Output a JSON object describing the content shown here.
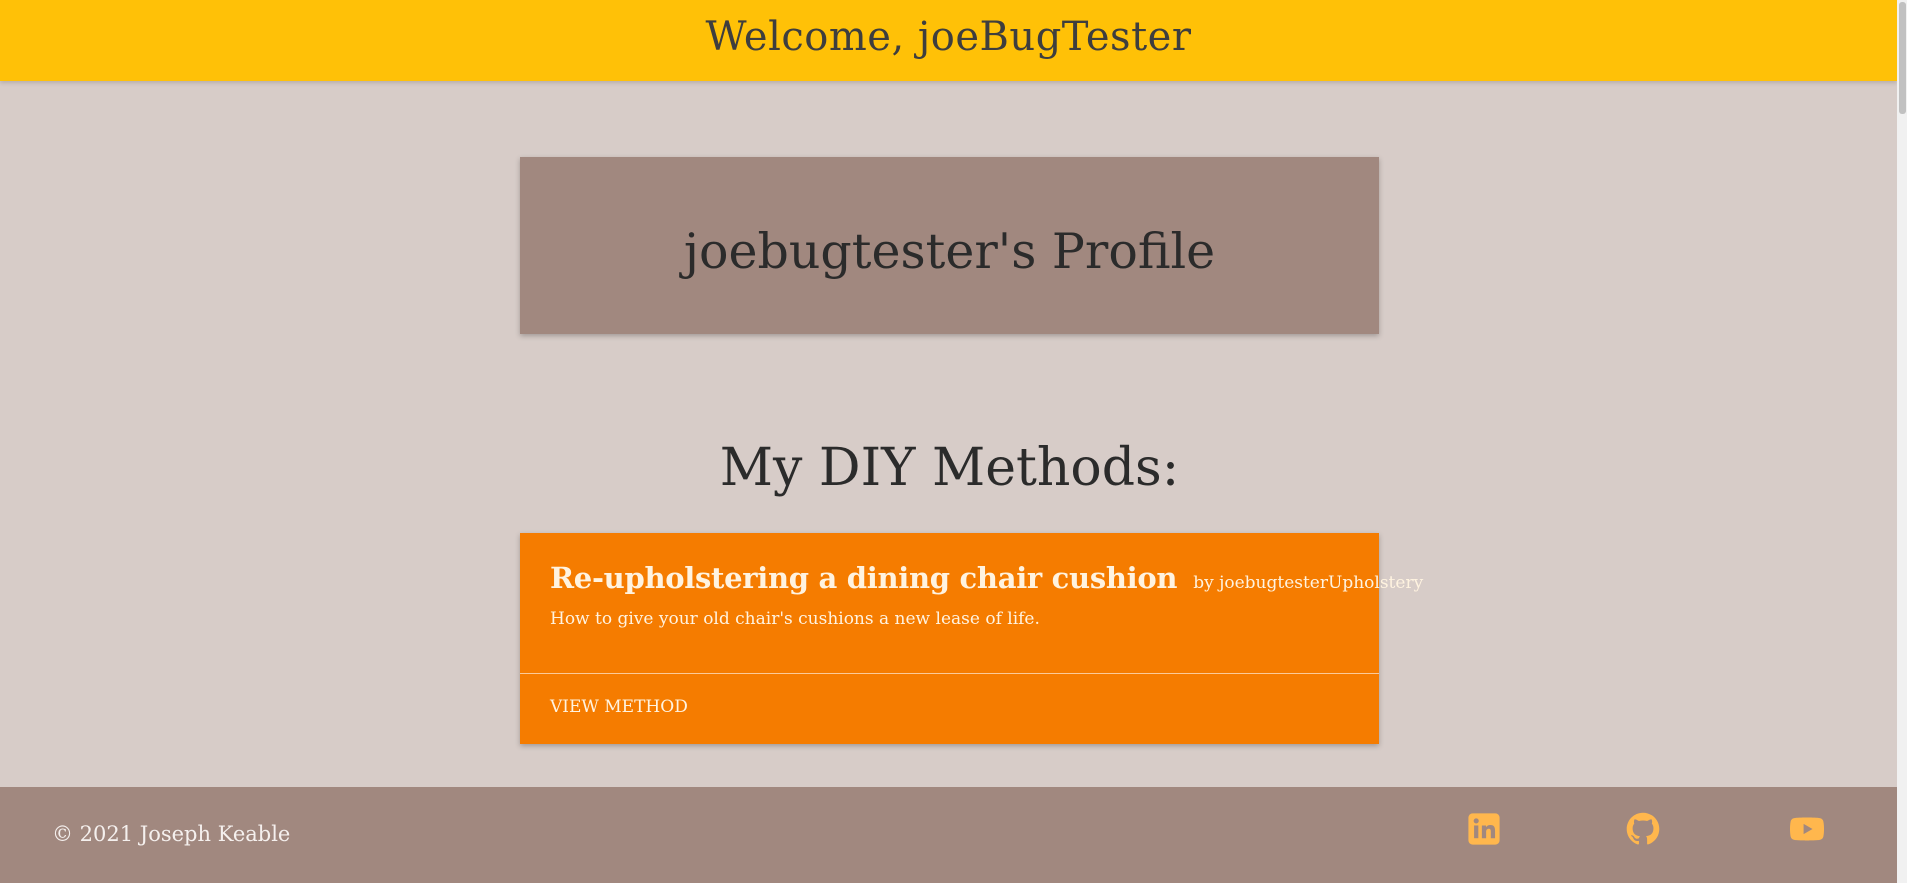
{
  "header": {
    "welcome_text": "Welcome, joeBugTester"
  },
  "profile": {
    "title": "joebugtester's Profile"
  },
  "methods_section": {
    "heading": "My DIY Methods:"
  },
  "methods": [
    {
      "title": "Re-upholstering a dining chair cushion",
      "author": "by joebugtester",
      "category": "Upholstery",
      "description": "How to give your old chair's cushions a new lease of life.",
      "action_label": "VIEW METHOD"
    }
  ],
  "footer": {
    "copyright": "© 2021 Joseph Keable",
    "social_links": [
      {
        "icon": "linkedin-icon"
      },
      {
        "icon": "github-icon"
      },
      {
        "icon": "youtube-icon"
      }
    ]
  },
  "colors": {
    "header_bg": "#ffc107",
    "page_bg": "#d7ccc8",
    "card_bg": "#a1887f",
    "method_card_bg": "#f57c00",
    "footer_bg": "#a1887f",
    "icon_color": "#ffb74d"
  }
}
